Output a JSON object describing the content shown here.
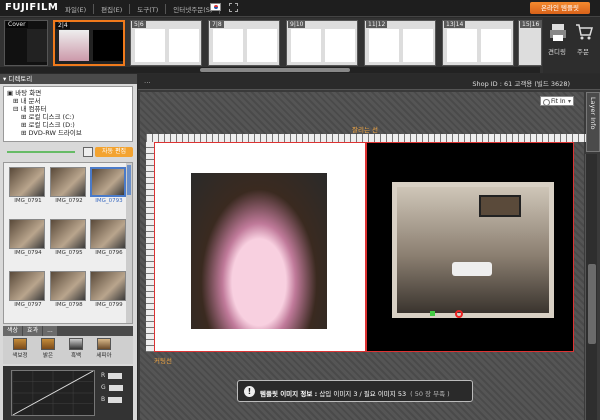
{
  "app": {
    "logo": "FUJIFILM",
    "menu": [
      "파일(E)",
      "편집(E)",
      "도구(T)",
      "인터넷주문(S)"
    ],
    "order_button": "온라인 템플릿"
  },
  "pages": [
    {
      "label": "Cover"
    },
    {
      "label": "2|4",
      "selected": true
    },
    {
      "label": "5|6"
    },
    {
      "label": "7|8"
    },
    {
      "label": "9|10"
    },
    {
      "label": "11|12"
    },
    {
      "label": "13|14"
    },
    {
      "label": "15|16"
    }
  ],
  "cart": {
    "item1": "견디링",
    "item2": "주문"
  },
  "left": {
    "directory_title": "디렉토리",
    "tree": [
      {
        "label": "바탕 화면",
        "level": 0
      },
      {
        "label": "내 문서",
        "level": 1
      },
      {
        "label": "내 컴퓨터",
        "level": 1
      },
      {
        "label": "로컬 디스크 (C:)",
        "level": 2
      },
      {
        "label": "로컬 디스크 (D:)",
        "level": 2
      },
      {
        "label": "DVD-RW 드라이브",
        "level": 2
      }
    ],
    "auto_edit": "자동 편집",
    "images": [
      {
        "name": "IMG_0791"
      },
      {
        "name": "IMG_0792"
      },
      {
        "name": "IMG_0793",
        "selected": true
      },
      {
        "name": "IMG_0794"
      },
      {
        "name": "IMG_0795"
      },
      {
        "name": "IMG_0796"
      },
      {
        "name": "IMG_0797"
      },
      {
        "name": "IMG_0798"
      },
      {
        "name": "IMG_0799"
      }
    ],
    "tabs": [
      "색상",
      "효과",
      "..."
    ],
    "tools": [
      "색보정",
      "밝은",
      "흑백",
      "세피아"
    ],
    "rgb": [
      "R",
      "G",
      "B"
    ]
  },
  "main": {
    "dots": "...",
    "shop_id": "Shop ID : 61 고객용 (빌드 3628)",
    "fit": "Fit In",
    "layer_info": "Layer Info",
    "cutline_top": "잘리는 선",
    "cutline_bottom": "커팅선",
    "info_icon": "!",
    "info_title": "템플릿 이미지 정보 :",
    "info_text": "삽입 이미지 3 / 필요 이미지 53",
    "info_sub": "( 50 장 부족 )"
  }
}
